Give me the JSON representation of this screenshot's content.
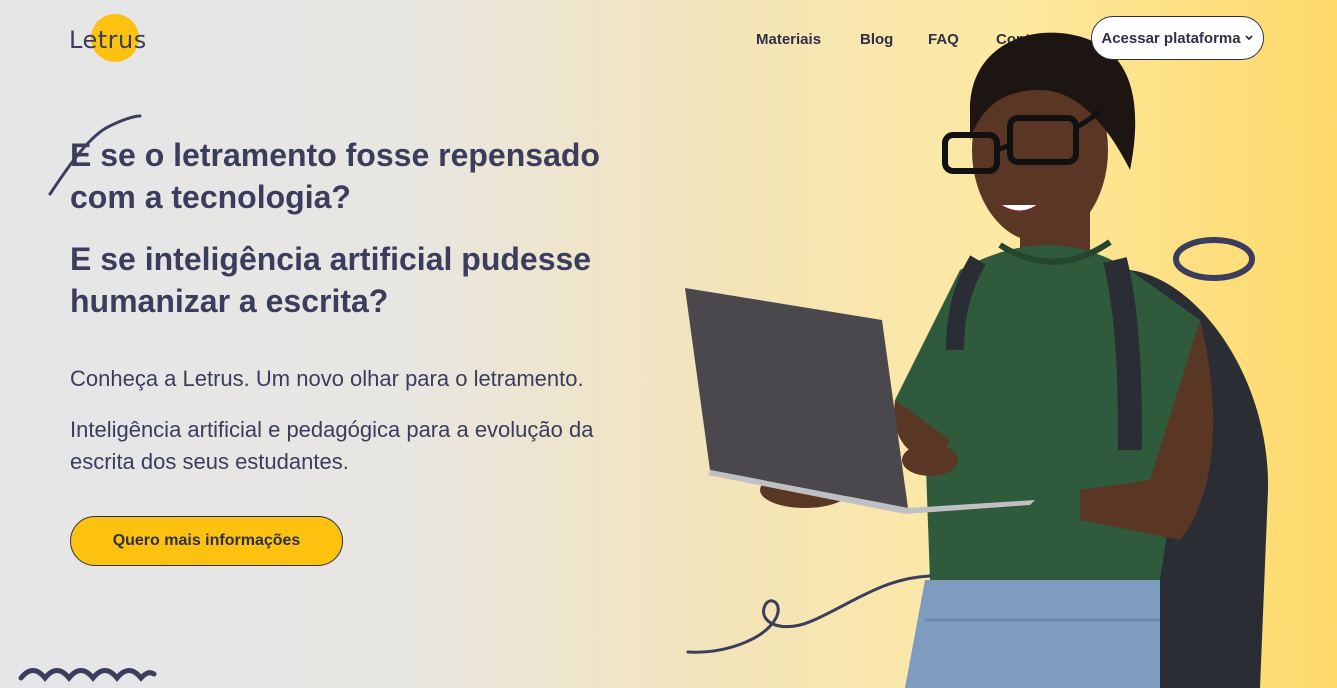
{
  "brand": {
    "logo_text": "Letrus",
    "accent": "#fdc10f",
    "ink": "#3a3d5c"
  },
  "nav": {
    "materiais": "Materiais",
    "blog": "Blog",
    "faq": "FAQ",
    "contato": "Contato",
    "access_button": "Acessar plataforma",
    "access_icon": "chevron-down-icon"
  },
  "hero": {
    "headline1": "E se o letramento fosse repensado com a tecnologia?",
    "headline2": "E se inteligência artificial pudesse humanizar a escrita?",
    "paragraph1": "Conheça a Letrus. Um novo olhar para o letramento.",
    "paragraph2": "Inteligência artificial e pedagógica para a evolução da escrita dos seus estudantes.",
    "cta": "Quero mais informações"
  }
}
